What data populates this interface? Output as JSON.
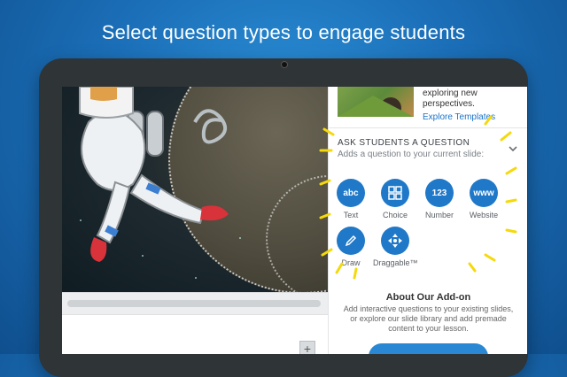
{
  "headline": "Select question types to engage students",
  "panel": {
    "promo_lines": [
      "exploring new",
      "perspectives."
    ],
    "explore_link": "Explore Templates",
    "ask_title": "ASK STUDENTS A QUESTION",
    "ask_subtitle": "Adds a question to your current slide:",
    "question_types": [
      {
        "label": "Text",
        "glyph": "abc",
        "icon": "text-icon"
      },
      {
        "label": "Choice",
        "glyph": "",
        "icon": "choice-grid-icon"
      },
      {
        "label": "Number",
        "glyph": "123",
        "icon": "number-icon"
      },
      {
        "label": "Website",
        "glyph": "www",
        "icon": "website-icon"
      },
      {
        "label": "Draw",
        "glyph": "",
        "icon": "pencil-icon"
      },
      {
        "label": "Draggable™",
        "glyph": "",
        "icon": "move-arrows-icon"
      }
    ],
    "about_title": "About Our Add-on",
    "about_lines": [
      "Add interactive questions to your existing slides,",
      "or explore our slide library and add premade",
      "content to your lesson."
    ]
  },
  "notes": {
    "add_glyph": "+"
  },
  "colors": {
    "accent": "#1f78c8",
    "sparkle": "#f5d90a",
    "background": "#1b6fb8"
  }
}
